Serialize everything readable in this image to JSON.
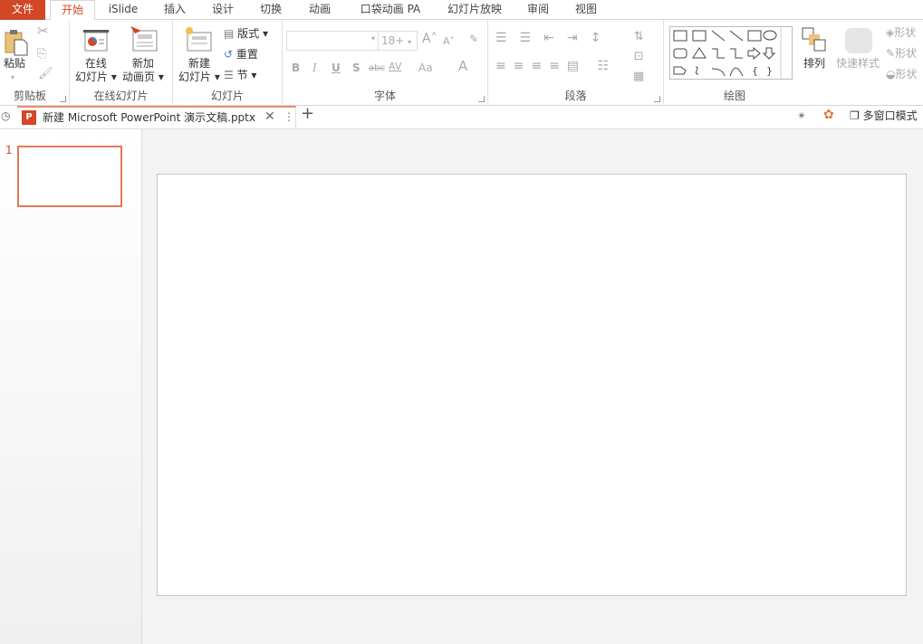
{
  "tabs": [
    "文件",
    "开始",
    "iSlide",
    "插入",
    "设计",
    "切换",
    "动画",
    "口袋动画 PA",
    "幻灯片放映",
    "审阅",
    "视图"
  ],
  "active_tab": "开始",
  "accent": "#d24726",
  "ribbon": {
    "clipboard": {
      "label": "剪贴板",
      "paste": "粘贴"
    },
    "online": {
      "label": "在线幻灯片",
      "online_slides": [
        "在线",
        "幻灯片"
      ],
      "add_anim": [
        "新加",
        "动画页"
      ]
    },
    "slides": {
      "label": "幻灯片",
      "new_slide": [
        "新建",
        "幻灯片"
      ],
      "layout": "版式",
      "reset": "重置",
      "section": "节"
    },
    "font": {
      "label": "字体",
      "font_name": "",
      "font_size": "18+",
      "bold": "B",
      "italic": "I",
      "underline": "U",
      "shadow": "S",
      "strike": "abc",
      "spacing": "AV",
      "case": "Aa",
      "color": "A"
    },
    "paragraph": {
      "label": "段落"
    },
    "drawing": {
      "label": "绘图",
      "arrange": "排列",
      "quick_styles": "快速样式",
      "fill": "形状",
      "outline": "形状",
      "effects": "形状"
    }
  },
  "doc_tab": {
    "title": "新建 Microsoft PowerPoint 演示文稿.pptx",
    "multiwindow": "多窗口模式"
  },
  "slides_pane": {
    "numbers": [
      "1"
    ]
  }
}
